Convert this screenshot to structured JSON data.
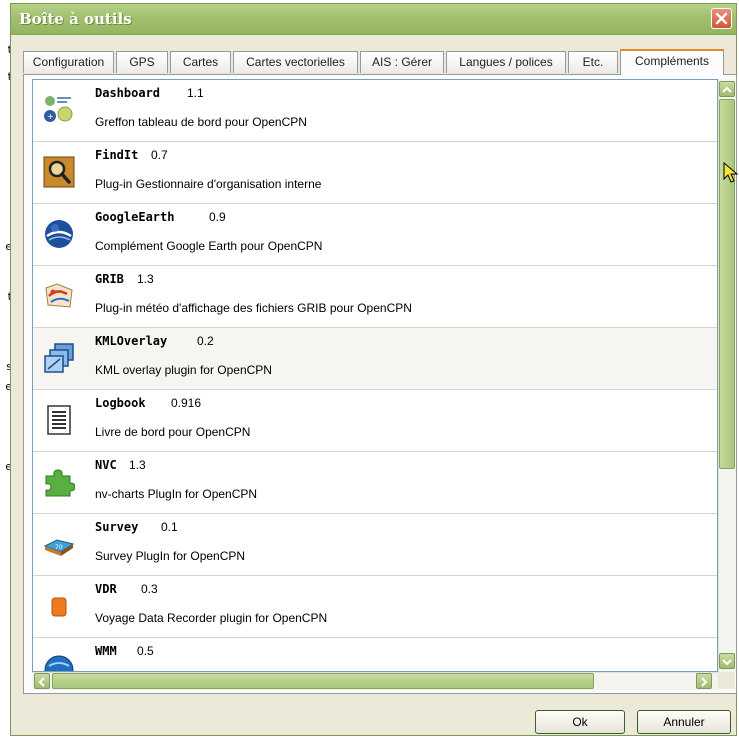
{
  "window": {
    "title": "Boîte à outils"
  },
  "background": {
    "fragments": [
      "t",
      "t",
      "e",
      "t",
      "s",
      "e",
      "e"
    ]
  },
  "tabs": [
    {
      "label": "Configuration",
      "active": false
    },
    {
      "label": "GPS",
      "active": false
    },
    {
      "label": "Cartes",
      "active": false
    },
    {
      "label": "Cartes vectorielles",
      "active": false
    },
    {
      "label": "AIS : Gérer",
      "active": false
    },
    {
      "label": "Langues / polices",
      "active": false
    },
    {
      "label": "Etc.",
      "active": false
    },
    {
      "label": "Compléments",
      "active": true
    }
  ],
  "plugins": [
    {
      "name": "Dashboard",
      "version": "1.1",
      "description": "Greffon tableau de bord pour OpenCPN",
      "icon": "dashboard-icon"
    },
    {
      "name": "FindIt",
      "version": "0.7",
      "description": "Plug-in Gestionnaire d'organisation interne",
      "icon": "magnifier-icon"
    },
    {
      "name": "GoogleEarth",
      "version": "0.9",
      "description": "Complément Google Earth pour OpenCPN",
      "icon": "globe-icon"
    },
    {
      "name": "GRIB",
      "version": "1.3",
      "description": "Plug-in météo d'affichage des fichiers GRIB pour OpenCPN",
      "icon": "weather-map-icon"
    },
    {
      "name": "KMLOverlay",
      "version": "0.2",
      "description": "KML overlay plugin for OpenCPN",
      "icon": "overlay-windows-icon"
    },
    {
      "name": "Logbook",
      "version": "0.916",
      "description": "Livre de bord pour OpenCPN",
      "icon": "document-icon"
    },
    {
      "name": "NVC",
      "version": "1.3",
      "description": "nv-charts PlugIn for OpenCPN",
      "icon": "puzzle-piece-icon"
    },
    {
      "name": "Survey",
      "version": "0.1",
      "description": "Survey PlugIn for OpenCPN",
      "icon": "survey-map-icon"
    },
    {
      "name": "VDR",
      "version": "0.3",
      "description": "Voyage Data Recorder plugin for OpenCPN",
      "icon": "recorder-icon"
    },
    {
      "name": "WMM",
      "version": "0.5",
      "description": "",
      "icon": "globe-icon"
    }
  ],
  "buttons": {
    "ok": "Ok",
    "cancel": "Annuler"
  },
  "colors": {
    "titlebar": "#a2c070",
    "active_tab_accent": "#e68b2c",
    "scroll_thumb": "#b5d089"
  }
}
